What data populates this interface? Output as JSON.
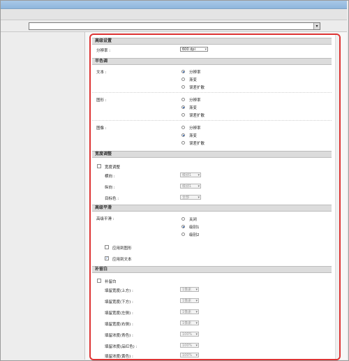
{
  "colors": {
    "highlight_box": "#dd3333",
    "title_bar": "#9fc0e2",
    "section_bg": "#dcdcdc"
  },
  "settings": {
    "sections": {
      "detail_settings": "高级设置",
      "halftone": "半色调",
      "density_adjust": "宽度调整",
      "advanced_smoothing": "高级平滑",
      "margin_whitespace": "补留白"
    },
    "resolution": {
      "label": "分辨率 :",
      "value": "600 dpi"
    },
    "halftone": {
      "text": {
        "label": "文本 :",
        "options": [
          "分辨率",
          "渐变",
          "误差扩散"
        ],
        "selected": 0
      },
      "graphics": {
        "label": "图形 :",
        "options": [
          "分辨率",
          "渐变",
          "误差扩散"
        ],
        "selected": 1
      },
      "image": {
        "label": "图像 :",
        "options": [
          "分辨率",
          "渐变",
          "误差扩散"
        ],
        "selected": 1
      }
    },
    "density": {
      "checkbox_label": "宽度调整",
      "horizontal": {
        "label": "横向 :",
        "value": "级别1"
      },
      "vertical": {
        "label": "纵向 :",
        "value": "级别1"
      },
      "target_color": {
        "label": "目标色 :",
        "value": "全部"
      }
    },
    "smoothing": {
      "label": "高级平滑 :",
      "options": [
        "关闭",
        "级别1",
        "级别2"
      ],
      "selected": 1,
      "apply_graphics": "应用到图形",
      "apply_text": "应用到文本"
    },
    "margin": {
      "checkbox_label": "补留白",
      "rows": [
        {
          "label": "填留宽度(上方) :",
          "value": "1像素"
        },
        {
          "label": "填留宽度(下方) :",
          "value": "1像素"
        },
        {
          "label": "填留宽度(左侧) :",
          "value": "1像素"
        },
        {
          "label": "填留宽度(右侧) :",
          "value": "1像素"
        },
        {
          "label": "填留浓度(青色) :",
          "value": "100%"
        },
        {
          "label": "填留浓度(品红色) :",
          "value": "100%"
        },
        {
          "label": "填留浓度(黄色) :",
          "value": "100%"
        }
      ]
    }
  }
}
